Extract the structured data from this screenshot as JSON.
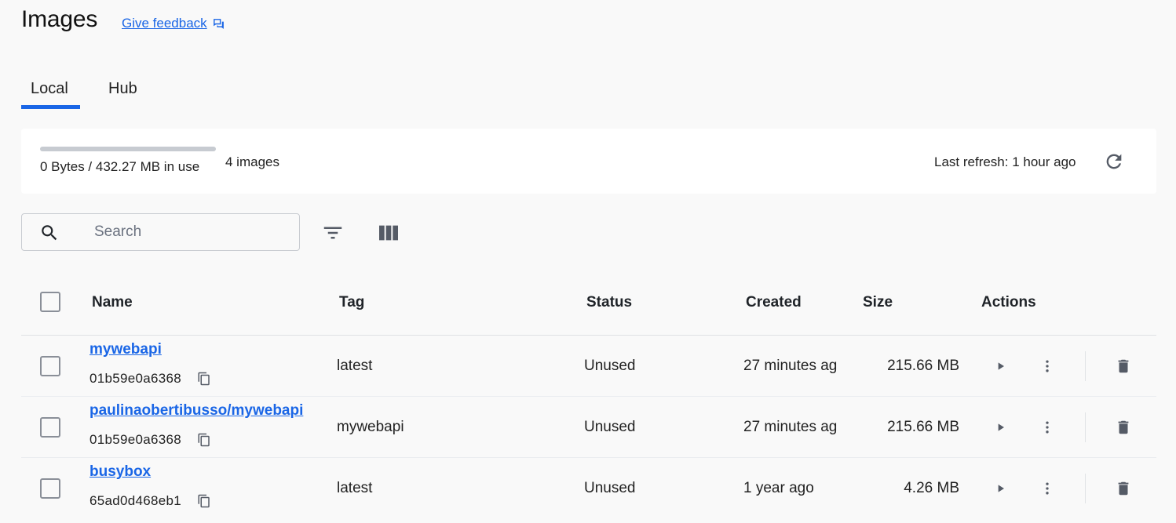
{
  "header": {
    "title": "Images",
    "feedback_label": "Give feedback"
  },
  "tabs": [
    {
      "label": "Local",
      "active": true
    },
    {
      "label": "Hub",
      "active": false
    }
  ],
  "summary": {
    "usage_text": "0 Bytes / 432.27 MB in use",
    "usage_fraction": 0,
    "image_count": "4 images",
    "last_refresh": "Last refresh: 1 hour ago"
  },
  "search": {
    "placeholder": "Search",
    "value": ""
  },
  "table": {
    "columns": [
      "Name",
      "Tag",
      "Status",
      "Created",
      "Size",
      "Actions"
    ],
    "rows": [
      {
        "name": "mywebapi",
        "id": "01b59e0a6368",
        "tag": "latest",
        "status": "Unused",
        "created": "27 minutes ag",
        "size": "215.66 MB"
      },
      {
        "name": "paulinaobertibusso/mywebapi",
        "id": "01b59e0a6368",
        "tag": "mywebapi",
        "status": "Unused",
        "created": "27 minutes ag",
        "size": "215.66 MB"
      },
      {
        "name": "busybox",
        "id": "65ad0d468eb1",
        "tag": "latest",
        "status": "Unused",
        "created": "1 year ago",
        "size": "4.26 MB"
      }
    ]
  },
  "icons": {
    "feedback": "feedback-icon",
    "refresh": "refresh-icon",
    "search": "search-icon",
    "filter": "filter-icon",
    "columns": "columns-icon",
    "copy": "copy-icon",
    "run": "play-icon",
    "more": "more-vertical-icon",
    "delete": "trash-icon"
  },
  "colors": {
    "accent": "#1a66e6",
    "background": "#f9f9f9",
    "card": "#ffffff",
    "usage_track": "#c7cbd1",
    "icon": "#555b66"
  }
}
